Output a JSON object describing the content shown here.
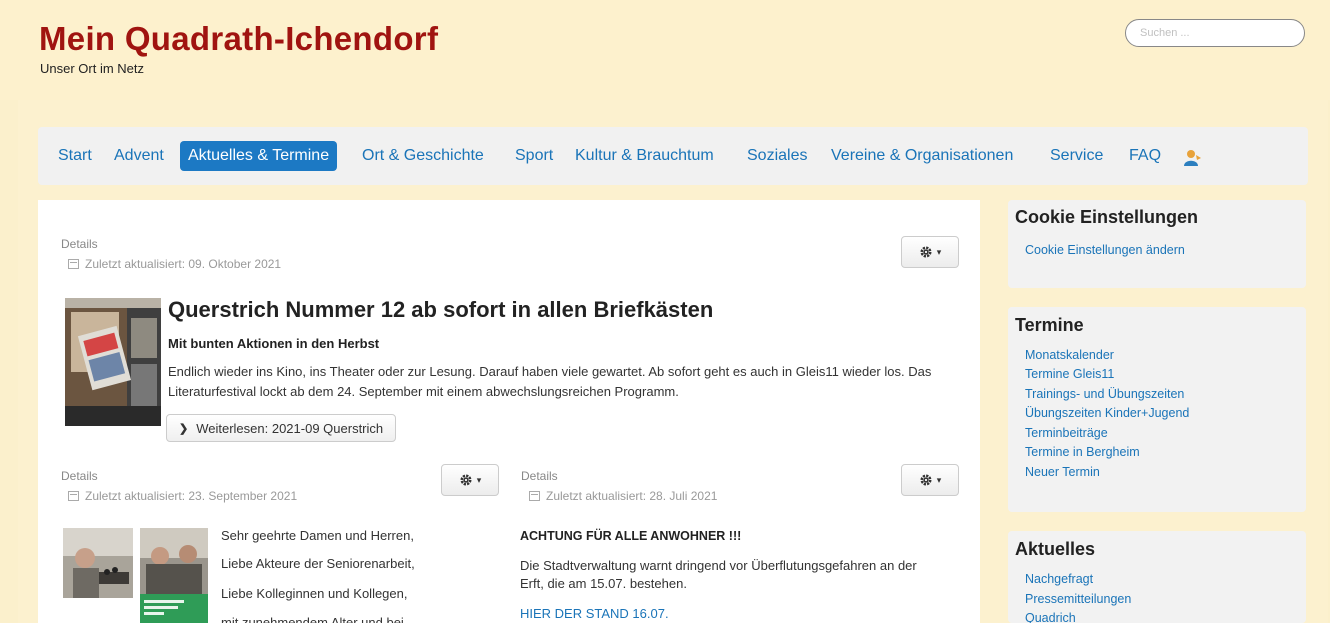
{
  "header": {
    "title": "Mein Quadrath-Ichendorf",
    "subtitle": "Unser Ort im Netz",
    "search_placeholder": "Suchen ..."
  },
  "nav": {
    "items": [
      {
        "label": "Start"
      },
      {
        "label": "Advent"
      },
      {
        "label": "Aktuelles & Termine",
        "active": true
      },
      {
        "label": "Ort & Geschichte"
      },
      {
        "label": "Sport"
      },
      {
        "label": "Kultur & Brauchtum"
      },
      {
        "label": "Soziales"
      },
      {
        "label": "Vereine & Organisationen"
      },
      {
        "label": "Service"
      },
      {
        "label": "FAQ"
      }
    ],
    "user_icon": "user-icon"
  },
  "featured": {
    "details_label": "Details",
    "updated": "Zuletzt aktualisiert: 09. Oktober 2021",
    "title": "Querstrich Nummer 12 ab sofort in allen Briefkästen",
    "subtitle": "Mit bunten Aktionen in den Herbst",
    "text": "Endlich wieder ins Kino, ins Theater oder zur Lesung. Darauf haben viele gewartet. Ab sofort geht es auch in Gleis11 wieder los. Das Literaturfestival lockt ab dem 24. September mit einem abwechslungsreichen Programm.",
    "readmore": "Weiterlesen: 2021-09 Querstrich"
  },
  "col1": {
    "details_label": "Details",
    "updated": "Zuletzt aktualisiert: 23. September 2021",
    "lines": [
      "Sehr geehrte Damen und Herren,",
      "Liebe Akteure der Seniorenarbeit,",
      "Liebe Kolleginnen und Kollegen,",
      "mit zunehmendem Alter und bei"
    ]
  },
  "col2": {
    "details_label": "Details",
    "updated": "Zuletzt aktualisiert: 28. Juli 2021",
    "heading": "ACHTUNG FÜR ALLE ANWOHNER !!!",
    "text_line1": "Die Stadtverwaltung warnt dringend vor Überflutungsgefahren an der",
    "text_line2": "Erft, die am 15.07. bestehen.",
    "link": "HIER DER STAND 16.07."
  },
  "sidebar": {
    "cookie": {
      "title": "Cookie Einstellungen",
      "link": "Cookie Einstellungen ändern"
    },
    "termine": {
      "title": "Termine",
      "links": [
        "Monatskalender",
        "Termine Gleis11",
        "Trainings- und Übungszeiten",
        "Übungszeiten Kinder+Jugend",
        "Terminbeiträge",
        "Termine in Bergheim",
        "Neuer Termin"
      ]
    },
    "aktuelles": {
      "title": "Aktuelles",
      "links": [
        "Nachgefragt",
        "Pressemitteilungen",
        "Quadrich"
      ]
    }
  },
  "colors": {
    "brand": "#a01410",
    "link": "#1a74b8",
    "nav_active": "#1c79c4",
    "background": "#fbf0cc"
  }
}
